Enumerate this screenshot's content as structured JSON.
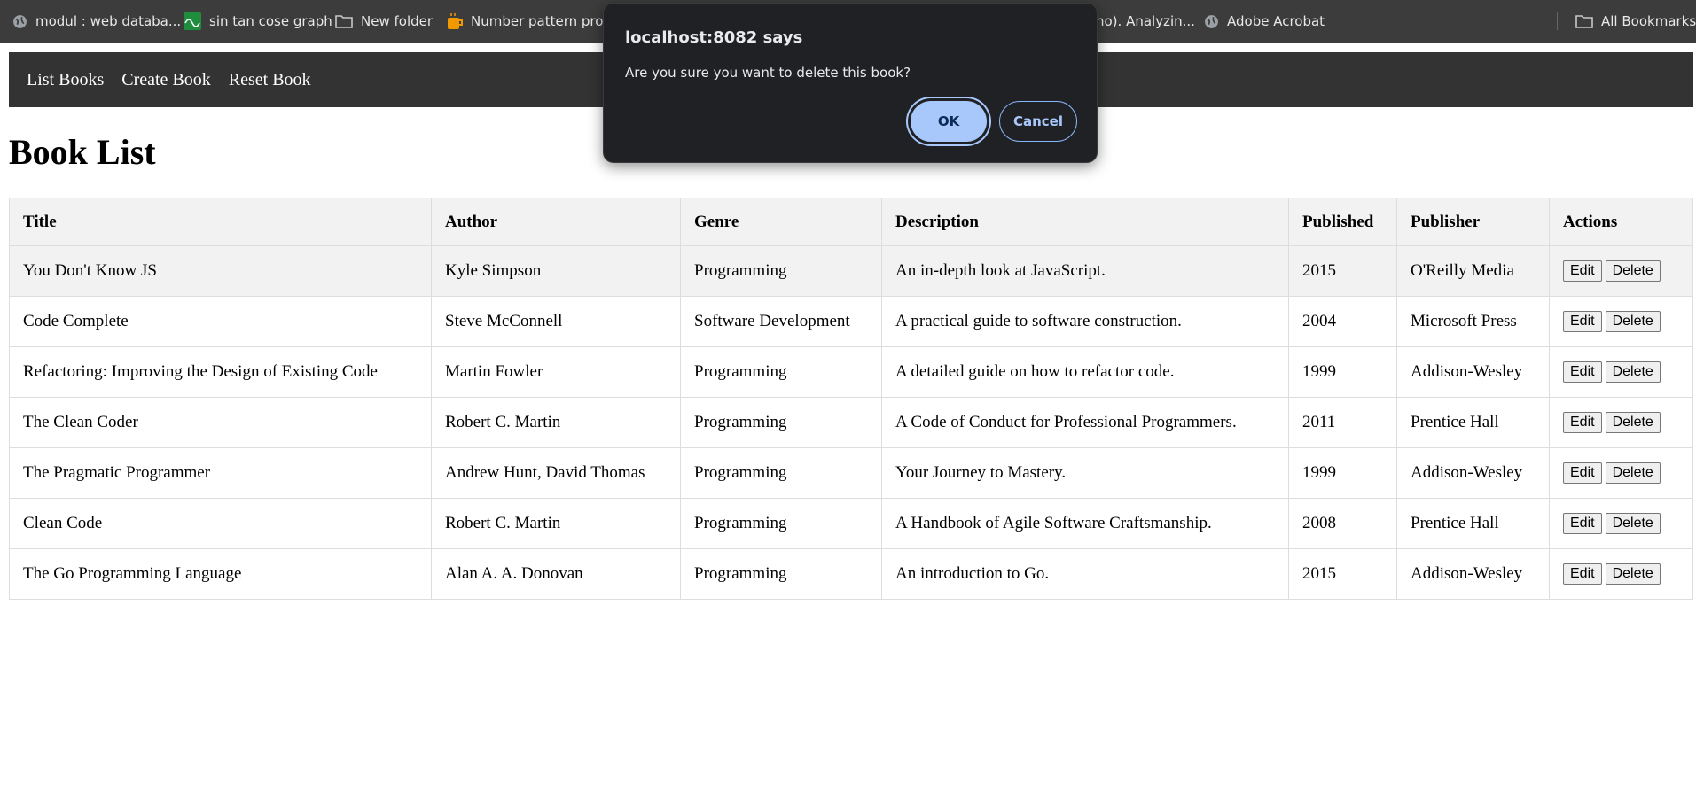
{
  "bookmarks": [
    {
      "label": "modul : web databa...",
      "icon": "globe-icon"
    },
    {
      "label": "sin tan cose graph",
      "icon": "graph-icon"
    },
    {
      "label": "New folder",
      "icon": "folder-icon"
    },
    {
      "label": "Number pattern pro...",
      "icon": "coffee-icon"
    },
    {
      "label": "no). Analyzin...",
      "icon": "partial"
    },
    {
      "label": "Adobe Acrobat",
      "icon": "globe-icon"
    },
    {
      "label": "All Bookmarks",
      "icon": "folder-icon"
    }
  ],
  "nav": {
    "list_books": "List Books",
    "create_book": "Create Book",
    "reset_book": "Reset Book"
  },
  "page_title": "Book List",
  "table": {
    "headers": [
      "Title",
      "Author",
      "Genre",
      "Description",
      "Published",
      "Publisher",
      "Actions"
    ],
    "rows": [
      {
        "title": "You Don't Know JS",
        "author": "Kyle Simpson",
        "genre": "Programming",
        "description": "An in-depth look at JavaScript.",
        "published": "2015",
        "publisher": "O'Reilly Media"
      },
      {
        "title": "Code Complete",
        "author": "Steve McConnell",
        "genre": "Software Development",
        "description": "A practical guide to software construction.",
        "published": "2004",
        "publisher": "Microsoft Press"
      },
      {
        "title": "Refactoring: Improving the Design of Existing Code",
        "author": "Martin Fowler",
        "genre": "Programming",
        "description": "A detailed guide on how to refactor code.",
        "published": "1999",
        "publisher": "Addison-Wesley"
      },
      {
        "title": "The Clean Coder",
        "author": "Robert C. Martin",
        "genre": "Programming",
        "description": "A Code of Conduct for Professional Programmers.",
        "published": "2011",
        "publisher": "Prentice Hall"
      },
      {
        "title": "The Pragmatic Programmer",
        "author": "Andrew Hunt, David Thomas",
        "genre": "Programming",
        "description": "Your Journey to Mastery.",
        "published": "1999",
        "publisher": "Addison-Wesley"
      },
      {
        "title": "Clean Code",
        "author": "Robert C. Martin",
        "genre": "Programming",
        "description": "A Handbook of Agile Software Craftsmanship.",
        "published": "2008",
        "publisher": "Prentice Hall"
      },
      {
        "title": "The Go Programming Language",
        "author": "Alan A. A. Donovan",
        "genre": "Programming",
        "description": "An introduction to Go.",
        "published": "2015",
        "publisher": "Addison-Wesley"
      }
    ],
    "edit_label": "Edit",
    "delete_label": "Delete"
  },
  "dialog": {
    "title": "localhost:8082 says",
    "message": "Are you sure you want to delete this book?",
    "ok_label": "OK",
    "cancel_label": "Cancel"
  },
  "colors": {
    "nav_bg": "#333333",
    "dialog_bg": "#202124",
    "dialog_accent": "#a8c7fa"
  }
}
